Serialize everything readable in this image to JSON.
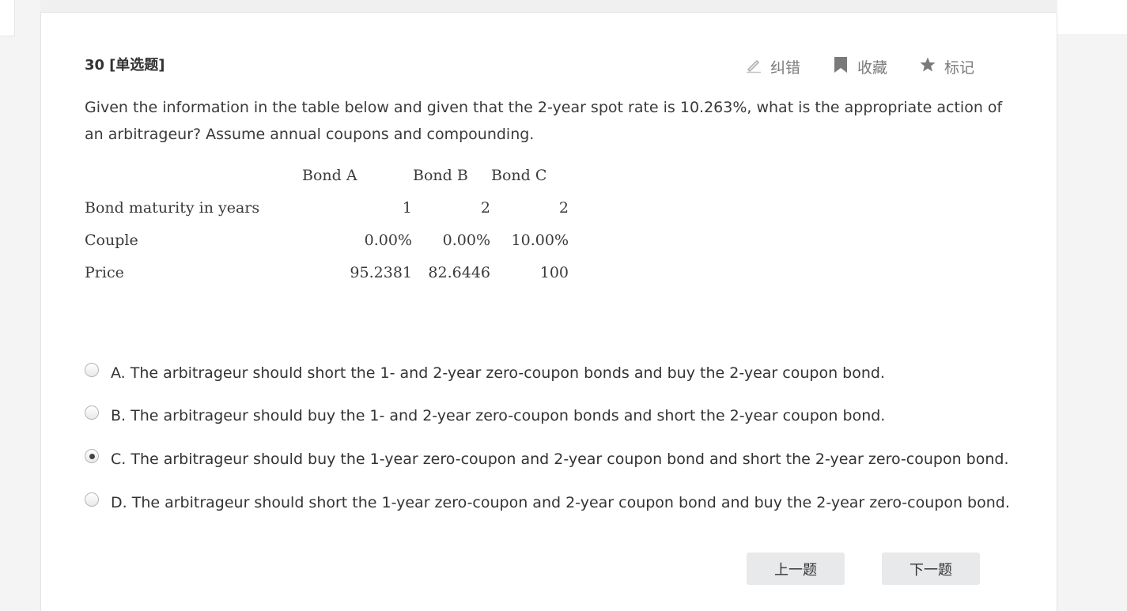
{
  "question": {
    "number": "30",
    "type": "[单选题]",
    "stem": "Given the information in the table below and given that the 2-year spot rate is 10.263%, what is the appropriate action of an arbitrageur? Assume annual coupons and compounding."
  },
  "tools": {
    "report_label": "纠错",
    "favorite_label": "收藏",
    "mark_label": "标记"
  },
  "table": {
    "headers": [
      "Bond A",
      "Bond B",
      "Bond C"
    ],
    "rows": [
      {
        "label": "Bond maturity in years",
        "values": [
          "1",
          "2",
          "2"
        ]
      },
      {
        "label": "Couple",
        "values": [
          "0.00%",
          "0.00%",
          "10.00%"
        ]
      },
      {
        "label": "Price",
        "values": [
          "95.2381",
          "82.6446",
          "100"
        ]
      }
    ]
  },
  "options": [
    {
      "text": "A. The arbitrageur should short the 1- and 2-year zero-coupon bonds and buy the 2-year coupon bond.",
      "selected": false
    },
    {
      "text": "B. The arbitrageur should buy the 1- and 2-year zero-coupon bonds and short the 2-year coupon bond.",
      "selected": false
    },
    {
      "text": "C. The arbitrageur should buy the 1-year zero-coupon and 2-year coupon bond and short the 2-year zero-coupon bond.",
      "selected": true
    },
    {
      "text": "D. The arbitrageur should short the 1-year zero-coupon and 2-year coupon bond and buy the 2-year zero-coupon bond.",
      "selected": false
    }
  ],
  "nav": {
    "prev_label": "上一题",
    "next_label": "下一题"
  },
  "colors": {
    "background": "#f4f4f5",
    "card": "#ffffff",
    "text": "#333333",
    "tool_text": "#7a7a7a",
    "button_bg": "#e8e9eb"
  },
  "icons": {
    "report": "pencil-icon",
    "favorite": "bookmark-icon",
    "mark": "star-icon"
  }
}
